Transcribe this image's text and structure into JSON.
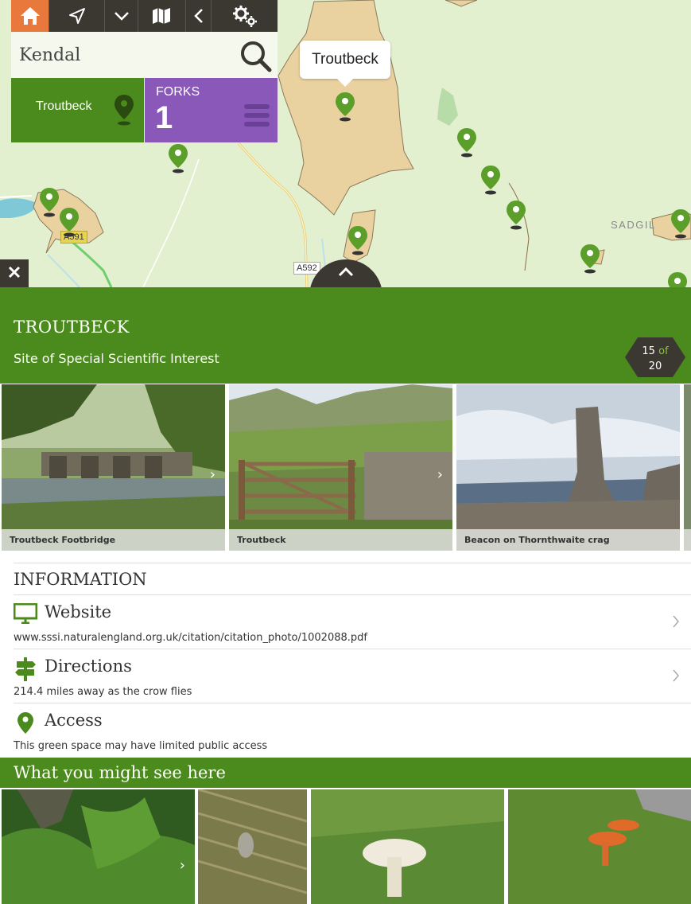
{
  "toolbar": {
    "buttons": [
      {
        "name": "home-icon"
      },
      {
        "name": "location-arrow-icon"
      },
      {
        "name": "chevron-down-icon"
      },
      {
        "name": "map-icon"
      },
      {
        "name": "chevron-left-icon"
      },
      {
        "name": "gears-icon"
      }
    ],
    "accent": "#e8783b"
  },
  "search": {
    "value": "Kendal",
    "placeholder": ""
  },
  "site_card": {
    "label": "Troutbeck"
  },
  "forks_card": {
    "label": "FORKS",
    "count": "1"
  },
  "map": {
    "bubble": "Troutbeck",
    "road_labels": [
      "A591",
      "A592"
    ],
    "place_labels": [
      "SADGIL"
    ]
  },
  "site": {
    "title": "TROUTBECK",
    "type": "Site of Special Scientific Interest",
    "index": "15",
    "of": "of",
    "total": "20"
  },
  "gallery": [
    {
      "caption": "Troutbeck Footbridge"
    },
    {
      "caption": "Troutbeck"
    },
    {
      "caption": "Beacon on Thornthwaite crag"
    }
  ],
  "info": {
    "heading": "INFORMATION",
    "rows": [
      {
        "title": "Website",
        "subtitle": "www.sssi.naturalengland.org.uk/citation/citation_photo/1002088.pdf",
        "icon": "monitor-icon"
      },
      {
        "title": "Directions",
        "subtitle": "214.4 miles away as the crow flies",
        "icon": "signpost-icon"
      },
      {
        "title": "Access",
        "subtitle": "This green space may have limited public access",
        "icon": "map-pin-icon"
      }
    ]
  },
  "see_here": {
    "title": "What you might see here"
  },
  "colors": {
    "green": "#4b8a1c",
    "purple": "#8a58b8",
    "dark": "#3b3731",
    "orange": "#e8783b"
  }
}
